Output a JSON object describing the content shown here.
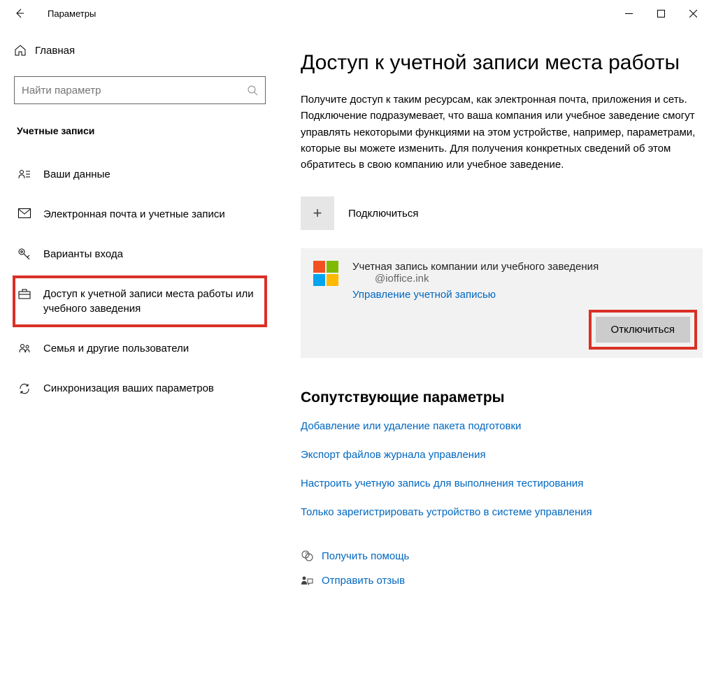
{
  "titlebar": {
    "title": "Параметры"
  },
  "sidebar": {
    "home": "Главная",
    "search_placeholder": "Найти параметр",
    "category": "Учетные записи",
    "items": [
      {
        "label": "Ваши данные"
      },
      {
        "label": "Электронная почта и учетные записи"
      },
      {
        "label": "Варианты входа"
      },
      {
        "label": "Доступ к учетной записи места работы или учебного заведения"
      },
      {
        "label": "Семья и другие пользователи"
      },
      {
        "label": "Синхронизация ваших параметров"
      }
    ]
  },
  "main": {
    "heading": "Доступ к учетной записи места работы",
    "description": "Получите доступ к таким ресурсам, как электронная почта, приложения и сеть. Подключение подразумевает, что ваша компания или учебное заведение смогут управлять некоторыми функциями на этом устройстве, например, параметрами, которые вы можете изменить. Для получения конкретных сведений об этом обратитесь в свою компанию или учебное заведение.",
    "connect": "Подключиться",
    "account": {
      "title": "Учетная запись компании или учебного заведения",
      "email": "@ioffice.ink",
      "manage": "Управление учетной записью",
      "disconnect": "Отключиться"
    },
    "related": {
      "heading": "Сопутствующие параметры",
      "links": [
        "Добавление или удаление пакета подготовки",
        "Экспорт файлов журнала управления",
        "Настроить учетную запись для выполнения тестирования",
        "Только зарегистрировать устройство в системе управления"
      ]
    },
    "help": {
      "get_help": "Получить помощь",
      "feedback": "Отправить отзыв"
    }
  }
}
